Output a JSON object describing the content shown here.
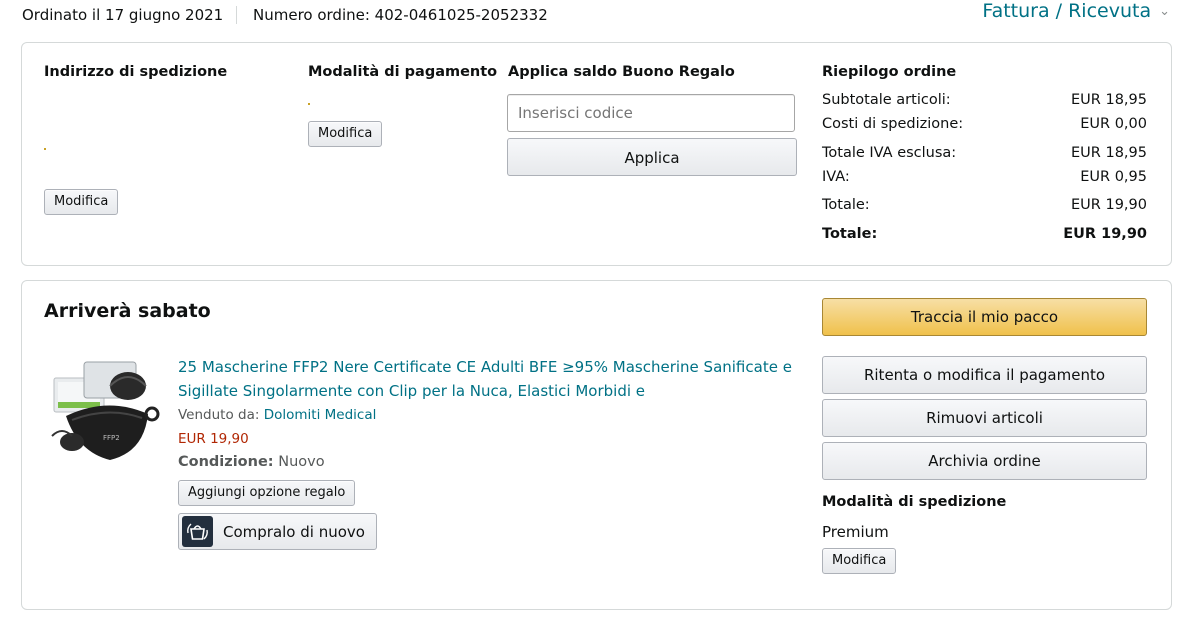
{
  "order_header": {
    "ordered_date": "Ordinato il 17 giugno 2021",
    "order_number": "Numero ordine: 402-0461025-2052332",
    "invoice_link": "Fattura / Ricevuta"
  },
  "details": {
    "shipping_address_title": "Indirizzo di spedizione",
    "shipping_modify": "Modifica",
    "payment_title": "Modalità di pagamento",
    "payment_modify": "Modifica",
    "gift_title": "Applica saldo Buono Regalo",
    "gift_placeholder": "Inserisci codice",
    "gift_apply": "Applica",
    "summary_title": "Riepilogo ordine",
    "summary_rows": [
      {
        "label": "Subtotale articoli:",
        "value": "EUR 18,95"
      },
      {
        "label": "Costi di spedizione:",
        "value": "EUR 0,00"
      },
      {
        "label": "Totale IVA esclusa:",
        "value": "EUR 18,95"
      },
      {
        "label": "IVA:",
        "value": "EUR 0,95"
      },
      {
        "label": "Totale:",
        "value": "EUR 19,90"
      }
    ],
    "grand_total_label": "Totale:",
    "grand_total_value": "EUR 19,90"
  },
  "shipment": {
    "status_title": "Arriverà sabato",
    "product_title_line1": "25 Mascherine FFP2 Nere Certificate CE Adulti BFE ≥95% Mascherine Sanificate e",
    "product_title_line2": "Sigillate Singolarmente con Clip per la Nuca, Elastici Morbidi e",
    "sold_by_label": "Venduto da:",
    "seller": "Dolomiti Medical",
    "price": "EUR 19,90",
    "condition_label": "Condizione:",
    "condition_value": "Nuovo",
    "gift_option_button": "Aggiungi opzione regalo",
    "buy_again_button": "Compralo di nuovo",
    "track_button": "Traccia il mio pacco",
    "retry_payment_button": "Ritenta o modifica il pagamento",
    "remove_items_button": "Rimuovi articoli",
    "archive_button": "Archivia ordine",
    "shipping_method_title": "Modalità di spedizione",
    "shipping_method_value": "Premium",
    "shipping_method_modify": "Modifica"
  },
  "icons": {
    "invoice_chevron": "chevron-down-icon",
    "buy_again": "buy-again-icon",
    "product_image": "mask-product-image"
  },
  "colors": {
    "link": "#007185",
    "price": "#b12704",
    "track_button": "#f0c14b"
  }
}
